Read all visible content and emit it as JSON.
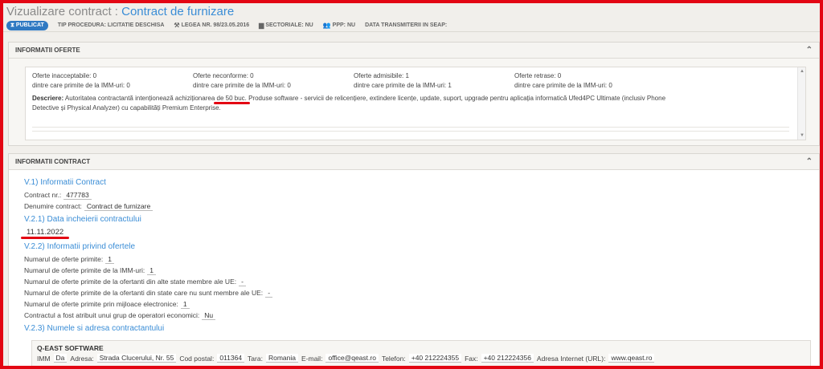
{
  "header": {
    "title_prefix": "Vizualizare contract : ",
    "title": "Contract de furnizare",
    "badge": "PUBLICAT",
    "tip_procedura": "TIP PROCEDURA: LICITATIE DESCHISA",
    "legea": "LEGEA NR. 98/23.05.2016",
    "sectoriale": "SECTORIALE: NU",
    "ppp": "PPP: NU",
    "data_transmiterii": "DATA TRANSMITERII IN SEAP:"
  },
  "oferte": {
    "heading": "INFORMATII OFERTE",
    "cells": [
      "Oferte inacceptabile: 0",
      "Oferte neconforme: 0",
      "Oferte admisibile: 1",
      "Oferte retrase: 0",
      "dintre care primite de la IMM-uri: 0",
      "dintre care primite de la IMM-uri: 0",
      "dintre care primite de la IMM-uri: 1",
      "dintre care primite de la IMM-uri: 0"
    ],
    "desc_label": "Descriere:",
    "desc_a": " Autoritatea contractantă intenționează achiziționarea ",
    "desc_u": "de 50 buc.",
    "desc_b": " Produse software - servicii de relicențiere, extindere licențe, update, suport, upgrade pentru aplicația informatică Ufed4PC Ultimate (inclusiv Phone Detective și Physical Analyzer) cu capabilități Premium Enterprise."
  },
  "contract": {
    "heading": "INFORMATII CONTRACT",
    "s1": "V.1) Informatii Contract",
    "nr_label": "Contract nr.:",
    "nr_value": "477783",
    "denumire_label": "Denumire contract:",
    "denumire_value": "Contract de furnizare",
    "s2": "V.2.1) Data incheierii contractului",
    "date_value": "11.11.2022",
    "s3": "V.2.2) Informatii privind ofertele",
    "rows": [
      {
        "label": "Numarul de oferte primite:",
        "value": "1"
      },
      {
        "label": "Numarul de oferte primite de la IMM-uri:",
        "value": "1"
      },
      {
        "label": "Numarul de oferte primite de la ofertanti din alte state membre ale UE:",
        "value": "-"
      },
      {
        "label": "Numarul de oferte primite de la ofertanti din state care nu sunt membre ale UE:",
        "value": "-"
      },
      {
        "label": "Numarul de oferte primite prin mijloace electronice:",
        "value": "1"
      },
      {
        "label": "Contractul a fost atribuit unui grup de operatori economici:",
        "value": "Nu"
      }
    ],
    "s4": "V.2.3) Numele si adresa contractantului",
    "contractor": {
      "name": "Q-EAST SOFTWARE",
      "imm_label": "IMM",
      "imm_value": "Da",
      "adresa_label": "Adresa:",
      "adresa_value": "Strada Clucerului, Nr. 55",
      "cod_label": "Cod postal:",
      "cod_value": "011364",
      "tara_label": "Tara:",
      "tara_value": "Romania",
      "email_label": "E-mail:",
      "email_value": "office@qeast.ro",
      "tel_label": "Telefon:",
      "tel_value": "+40 212224355",
      "fax_label": "Fax:",
      "fax_value": "+40 212224356",
      "url_label": "Adresa Internet (URL):",
      "url_value": "www.qeast.ro"
    }
  }
}
